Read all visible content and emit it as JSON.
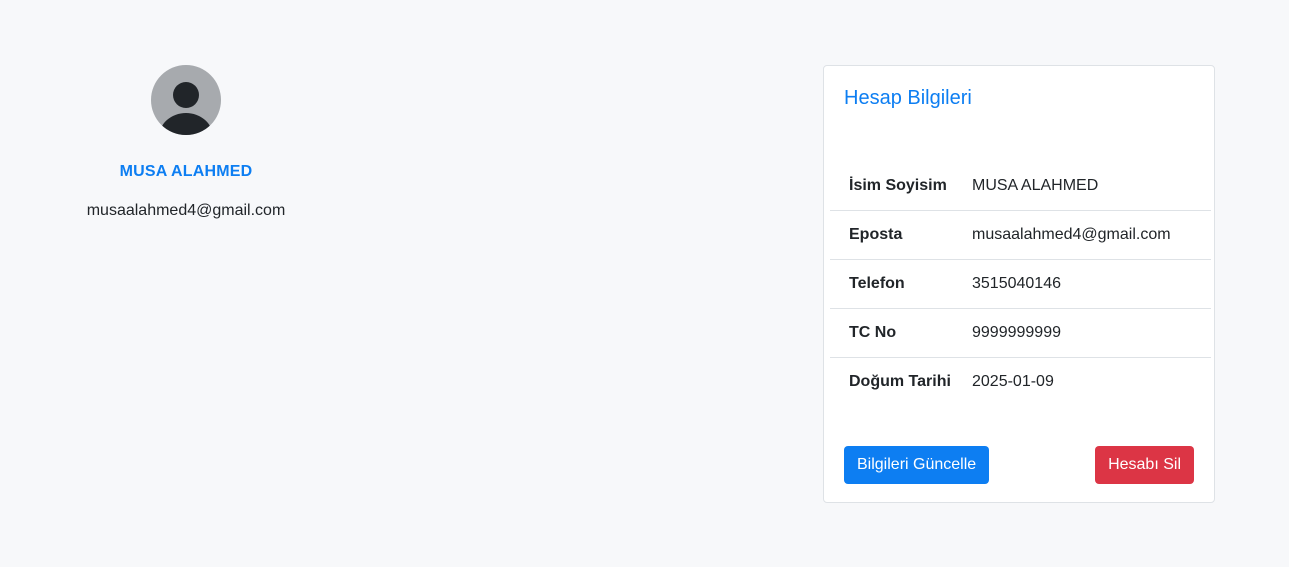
{
  "profile": {
    "name": "MUSA ALAHMED",
    "email": "musaalahmed4@gmail.com",
    "avatar_icon": "user-avatar-icon"
  },
  "card": {
    "title": "Hesap Bilgileri",
    "rows": [
      {
        "label": "İsim Soyisim",
        "value": "MUSA ALAHMED"
      },
      {
        "label": "Eposta",
        "value": "musaalahmed4@gmail.com"
      },
      {
        "label": "Telefon",
        "value": "3515040146"
      },
      {
        "label": "TC No",
        "value": "9999999999"
      },
      {
        "label": "Doğum Tarihi",
        "value": "2025-01-09"
      }
    ],
    "update_button": "Bilgileri Güncelle",
    "delete_button": "Hesabı Sil"
  },
  "colors": {
    "accent": "#0d7ef2",
    "danger": "#dc3545",
    "background": "#f7f8fa",
    "avatar_bg": "#a7aaae",
    "avatar_fg": "#212529"
  }
}
